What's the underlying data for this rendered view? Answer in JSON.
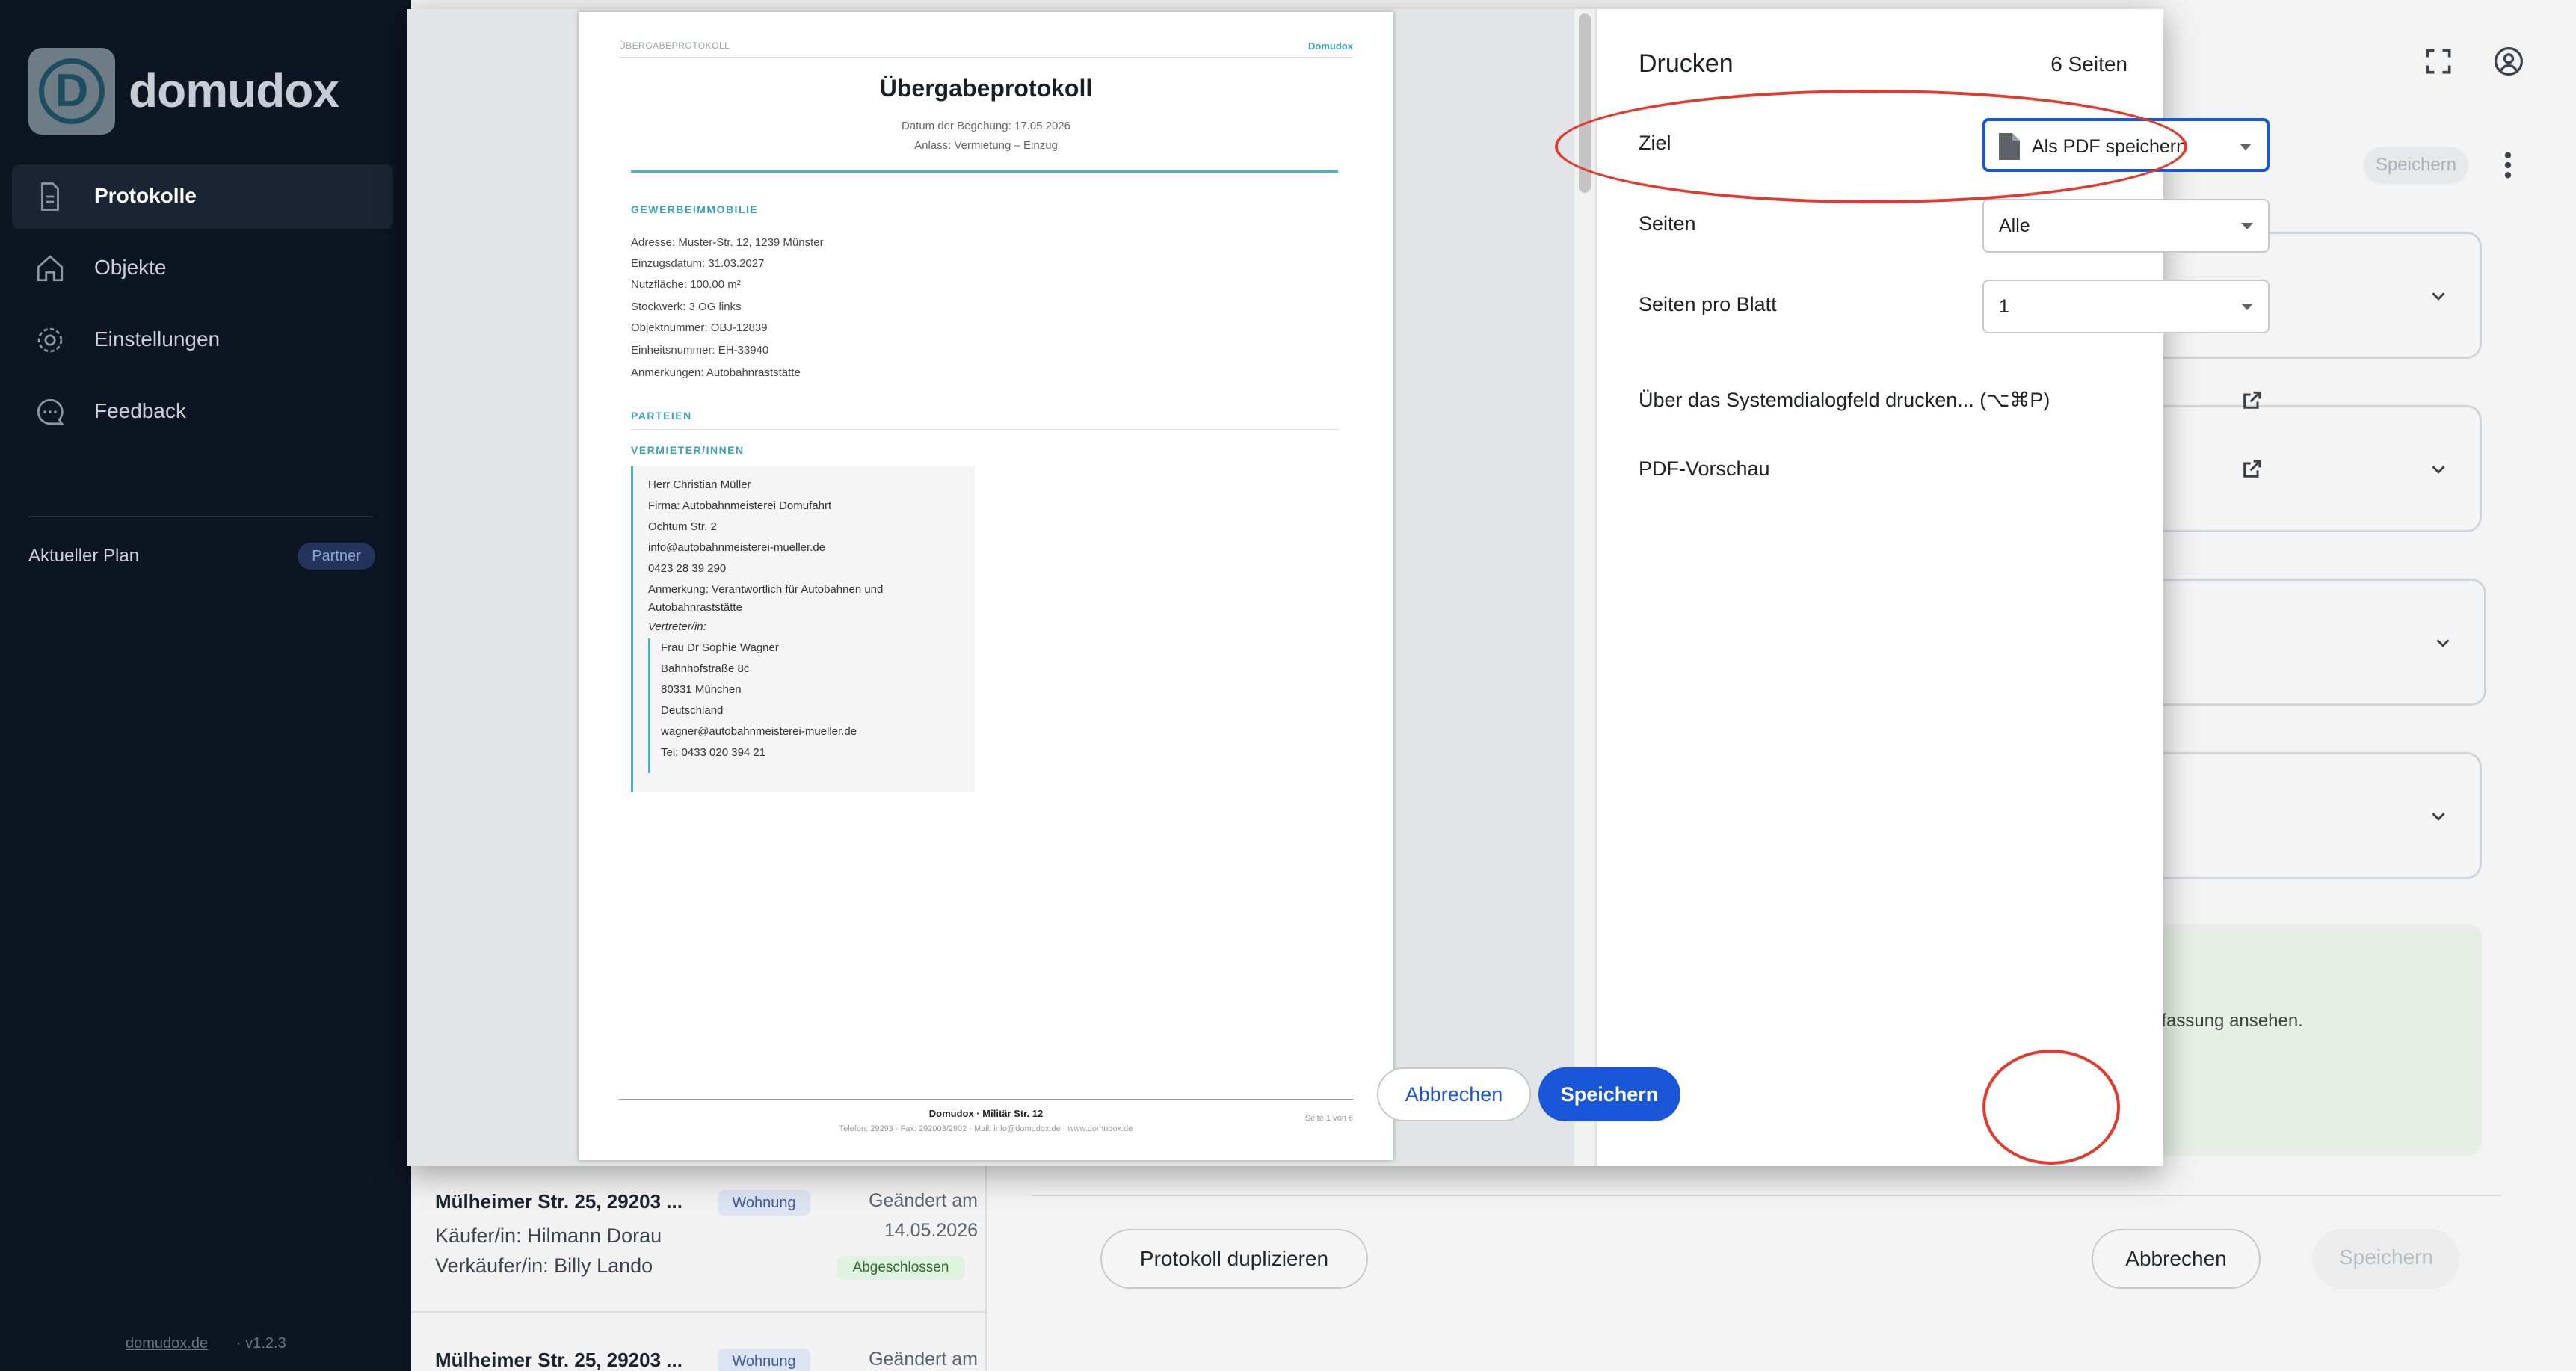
{
  "app": {
    "brand": "domudox",
    "logo_letter": "D",
    "nav": [
      {
        "label": "Protokolle",
        "icon": "document-icon",
        "active": true
      },
      {
        "label": "Objekte",
        "icon": "home-icon",
        "active": false
      },
      {
        "label": "Einstellungen",
        "icon": "gear-icon",
        "active": false
      },
      {
        "label": "Feedback",
        "icon": "chat-icon",
        "active": false
      }
    ],
    "plan_label": "Aktueller Plan",
    "plan_badge": "Partner",
    "footer_link": "domudox.de",
    "footer_version": "· v1.2.3"
  },
  "background": {
    "save_chip": "Speichern",
    "info_text": "nfassung ansehen.",
    "duplicate_button": "Protokoll duplizieren",
    "cancel_button": "Abbrechen",
    "save_button": "Speichern",
    "list": [
      {
        "title": "Mülheimer Str. 25, 29203 ...",
        "badge": "Wohnung",
        "changed_label": "Geändert am",
        "changed_date": "14.05.2026",
        "line1": "Käufer/in: Hilmann Dorau",
        "line2": "Verkäufer/in: Billy Lando",
        "status": "Abgeschlossen"
      },
      {
        "title": "Mülheimer Str. 25, 29203 ...",
        "badge": "Wohnung",
        "changed_label": "Geändert am"
      }
    ]
  },
  "print_dialog": {
    "title": "Drucken",
    "page_count": "6 Seiten",
    "fields": {
      "ziel_label": "Ziel",
      "ziel_value": "Als PDF speichern",
      "seiten_label": "Seiten",
      "seiten_value": "Alle",
      "pro_blatt_label": "Seiten pro Blatt",
      "pro_blatt_value": "1"
    },
    "links": {
      "system_dialog": "Über das Systemdialogfeld drucken... (⌥⌘P)",
      "pdf_preview": "PDF-Vorschau"
    },
    "cancel_button": "Abbrechen",
    "save_button": "Speichern"
  },
  "document": {
    "header_left": "ÜBERGABEPROTOKOLL",
    "header_right": "Domudox",
    "title": "Übergabeprotokoll",
    "date_line": "Datum der Begehung: 17.05.2026",
    "occasion_line": "Anlass: Vermietung – Einzug",
    "section_property": "GEWERBEIMMOBILIE",
    "property_lines": [
      "Adresse: Muster-Str. 12, 1239 Münster",
      "Einzugsdatum: 31.03.2027",
      "Nutzfläche: 100.00 m²",
      "Stockwerk: 3 OG links",
      "Objektnummer: OBJ-12839",
      "Einheitsnummer: EH-33940",
      "Anmerkungen: Autobahnraststätte"
    ],
    "section_parties": "PARTEIEN",
    "section_landlords": "VERMIETER/INNEN",
    "landlord_lines": [
      "Herr Christian Müller",
      "Firma: Autobahnmeisterei Domufahrt",
      "Ochtum Str. 2",
      "info@autobahnmeisterei-mueller.de",
      "0423 28 39 290",
      "Anmerkung: Verantwortlich für Autobahnen und",
      "Autobahnraststätte"
    ],
    "representative_label": "Vertreter/in:",
    "representative_lines": [
      "Frau Dr Sophie Wagner",
      "Bahnhofstraße 8c",
      "80331 München",
      "Deutschland",
      "wagner@autobahnmeisterei-mueller.de",
      "Tel: 0433 020 394 21"
    ],
    "footer_company": "Domudox · Militär Str. 12",
    "footer_contact": "Telefon: 29293 · Fax: 292003/2902 · Mail: info@domudox.de · www.domudox.de",
    "footer_page": "Seite 1 von 6"
  },
  "colors": {
    "accent_blue": "#1a56d8",
    "annotation_red": "#e23a2c",
    "teal": "#45b3c2",
    "sidebar_bg": "#0d1522"
  }
}
